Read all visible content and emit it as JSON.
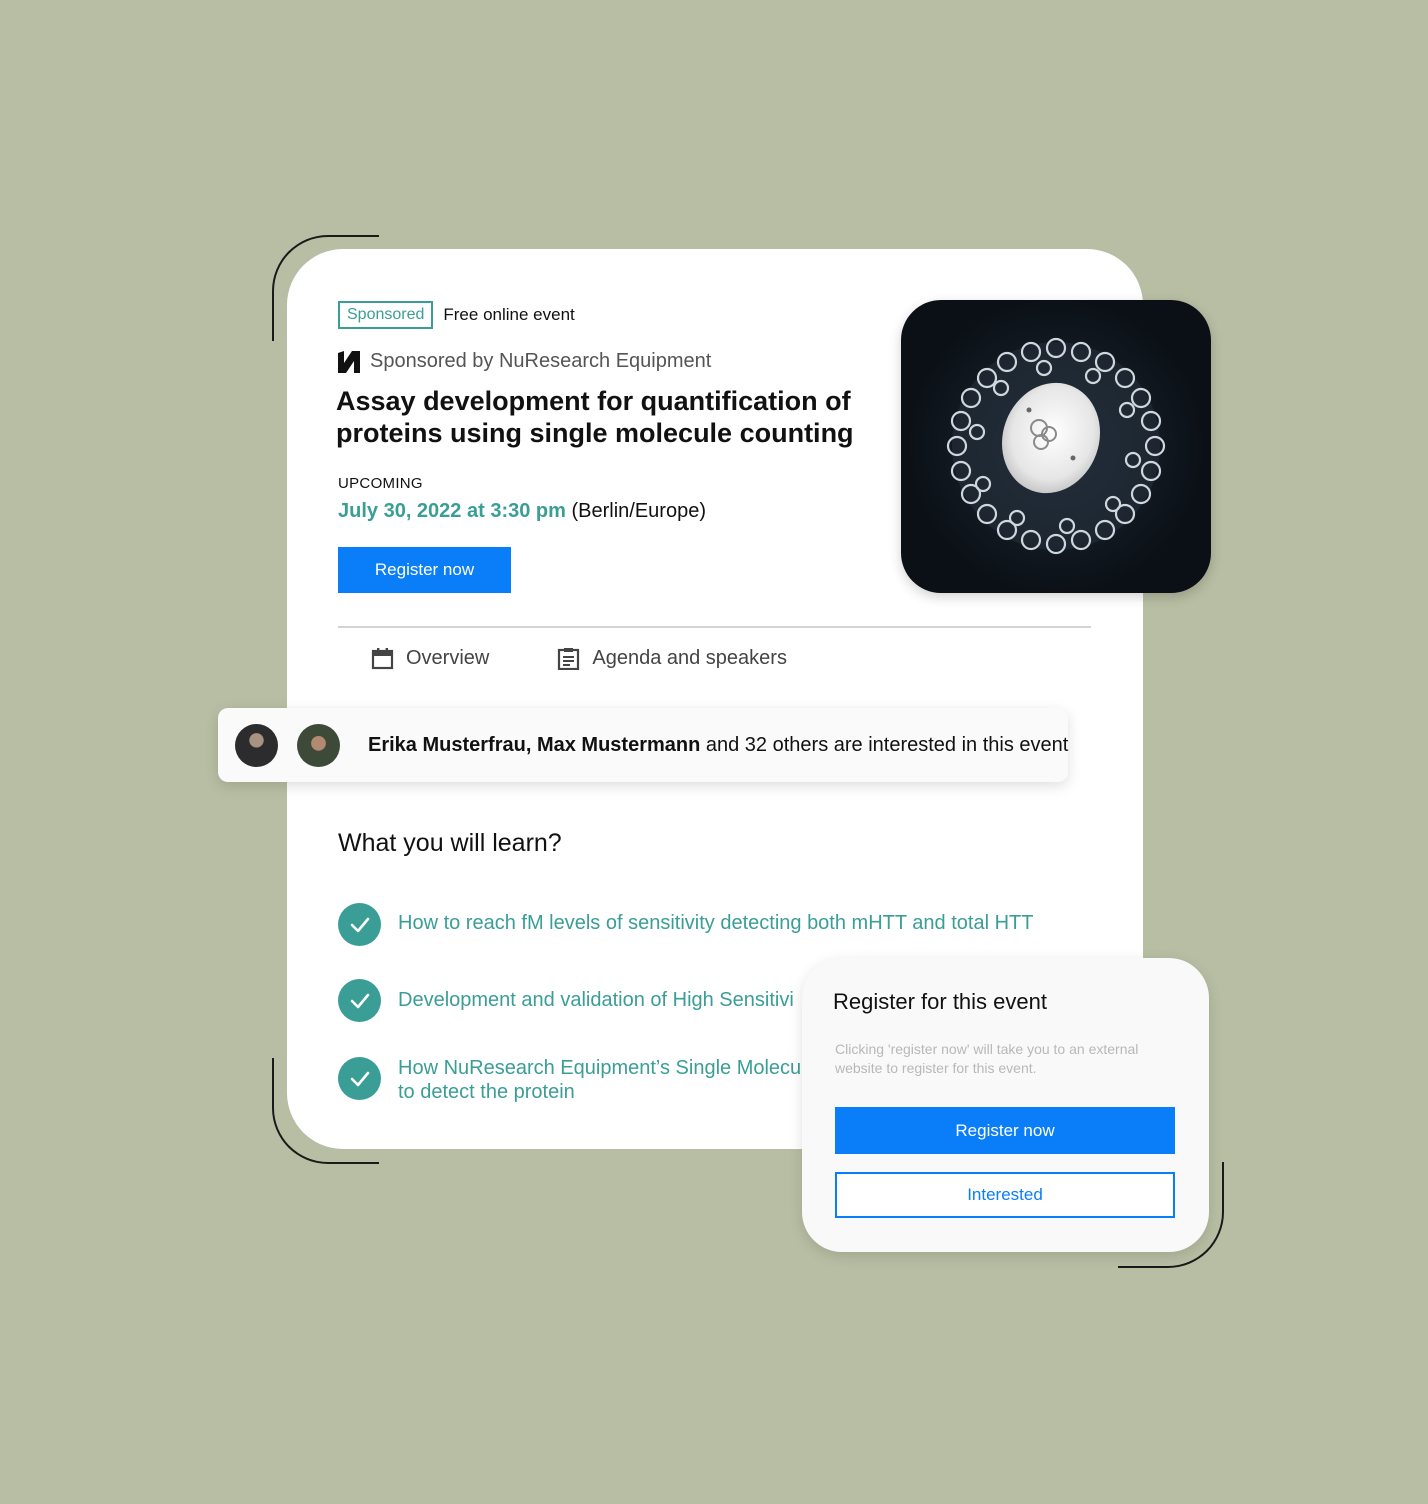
{
  "event": {
    "sponsored_badge": "Sponsored",
    "event_type": "Free online event",
    "sponsor_line": "Sponsored by NuResearch Equipment",
    "title": "Assay development for quantification of proteins using single molecule counting",
    "status": "UPCOMING",
    "date": "July 30, 2022 at 3:30 pm",
    "timezone": "(Berlin/Europe)",
    "register_label": "Register now",
    "logo_icon": "nuresearch-logo-icon",
    "image": "virus-particle-photo"
  },
  "tabs": [
    {
      "label": "Overview",
      "icon": "calendar-icon"
    },
    {
      "label": "Agenda and speakers",
      "icon": "clipboard-icon"
    }
  ],
  "interest": {
    "names": "Erika Musterfrau, Max Mustermann",
    "rest": " and 32 others are interested in this event"
  },
  "learn": {
    "heading": "What you will learn?",
    "items": [
      "How to reach fM levels of sensitivity detecting both mHTT and total HTT",
      "Development and validation of High Sensitivi",
      "How NuResearch Equipment’s Single Molecul to detect the protein"
    ]
  },
  "register_panel": {
    "title": "Register for this event",
    "note": "Clicking 'register now' will take you to an external website to register for this event.",
    "register_label": "Register now",
    "interested_label": "Interested"
  },
  "colors": {
    "background": "#b7bea3",
    "accent_teal": "#3a9e97",
    "primary_blue": "#0a7ef8"
  }
}
